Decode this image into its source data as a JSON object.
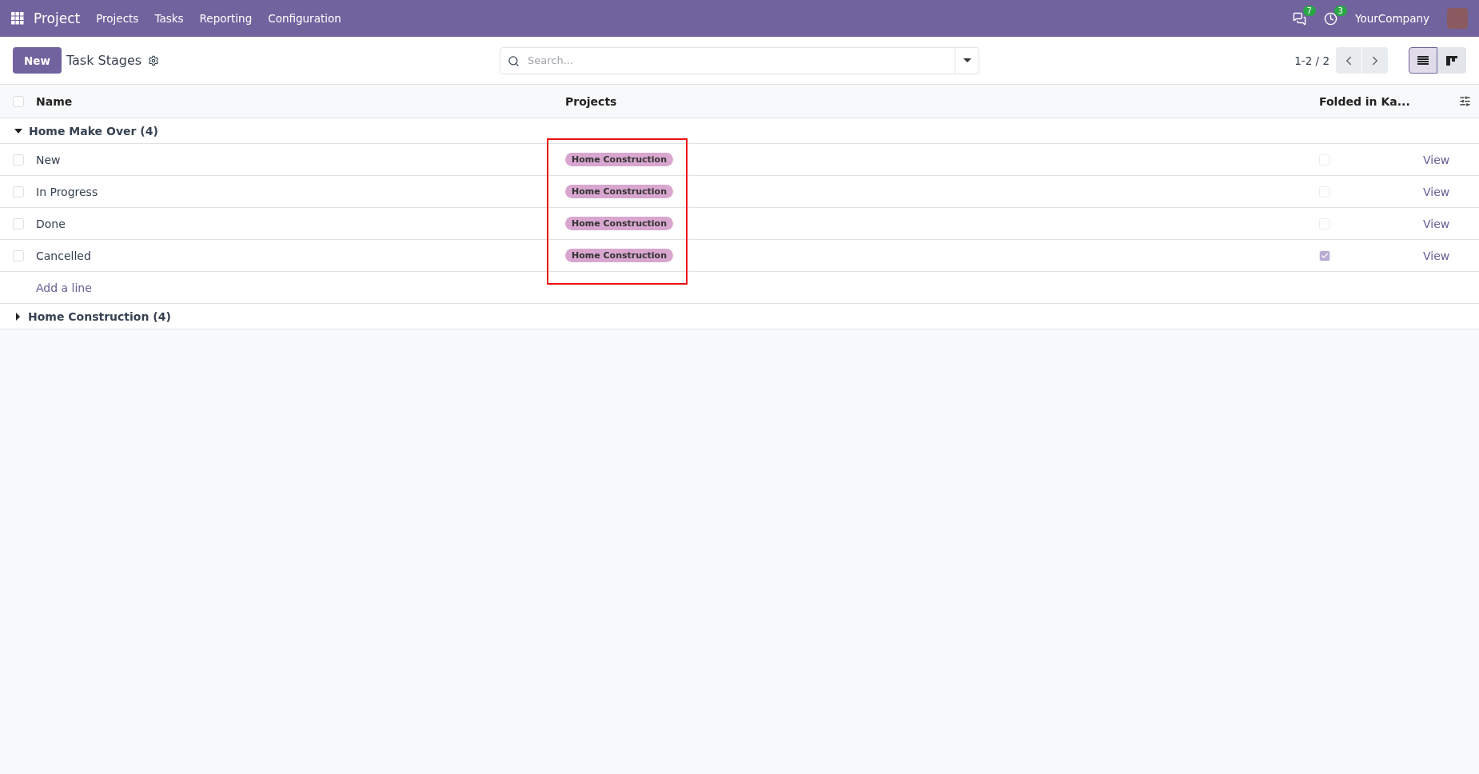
{
  "navbar": {
    "app_name": "Project",
    "menu": [
      "Projects",
      "Tasks",
      "Reporting",
      "Configuration"
    ],
    "messages_count": "7",
    "activities_count": "3",
    "company": "YourCompany"
  },
  "control_panel": {
    "new_button": "New",
    "title": "Task Stages",
    "search": {
      "placeholder": "Search..."
    },
    "pager": "1-2 / 2",
    "views": [
      {
        "kind": "list",
        "selected": true
      },
      {
        "kind": "kanban",
        "selected": false
      }
    ]
  },
  "table": {
    "select_all_checked": false,
    "columns": [
      "Name",
      "Projects",
      "Folded in Ka..."
    ],
    "groups": [
      {
        "label": "Home Make Over (4)",
        "expanded": true,
        "rows": [
          {
            "checked": false,
            "name": "New",
            "project": "Home Construction",
            "folded": false,
            "action": "View"
          },
          {
            "checked": false,
            "name": "In Progress",
            "project": "Home Construction",
            "folded": false,
            "action": "View"
          },
          {
            "checked": false,
            "name": "Done",
            "project": "Home Construction",
            "folded": false,
            "action": "View"
          },
          {
            "checked": false,
            "name": "Cancelled",
            "project": "Home Construction",
            "folded": true,
            "action": "View"
          }
        ],
        "add_line": "Add a line"
      },
      {
        "label": "Home Construction (4)",
        "expanded": false
      }
    ]
  }
}
